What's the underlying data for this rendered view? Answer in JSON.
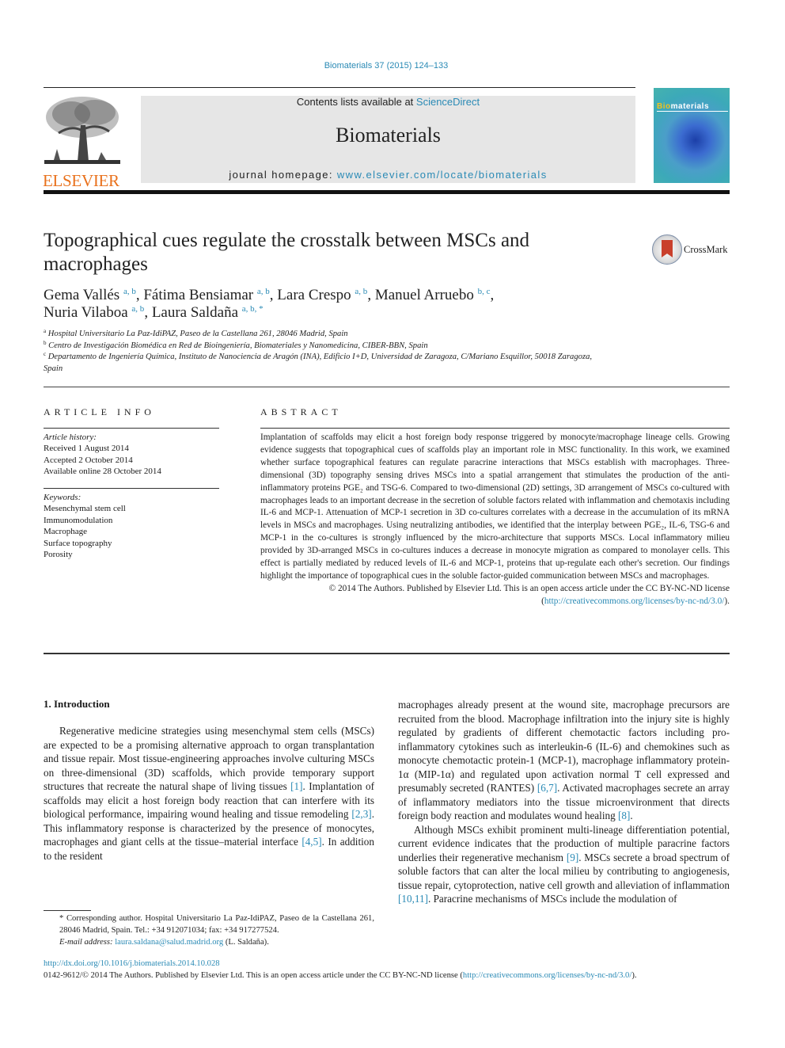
{
  "header": {
    "journal_ref": "Biomaterials 37 (2015) 124–133",
    "contents_prefix": "Contents lists available at ",
    "contents_link": "ScienceDirect",
    "journal_name": "Biomaterials",
    "homepage_prefix": "journal homepage: ",
    "homepage_link": "www.elsevier.com/locate/biomaterials",
    "publisher_logo_text": "ELSEVIER",
    "cover_title_highlight": "Bio",
    "cover_title_rest": "materials",
    "crossmark_label": "CrossMark",
    "colors": {
      "link": "#2a8ab5",
      "elsevier_orange": "#e9711c",
      "banner_bg": "#e6e6e6"
    }
  },
  "article": {
    "title": "Topographical cues regulate the crosstalk between MSCs and macrophages",
    "authors": [
      {
        "name": "Gema Vallés",
        "affil": "a, b",
        "sep": ", "
      },
      {
        "name": "Fátima Bensiamar",
        "affil": "a, b",
        "sep": ", "
      },
      {
        "name": "Lara Crespo",
        "affil": "a, b",
        "sep": ", "
      },
      {
        "name": "Manuel Arruebo",
        "affil": "b, c",
        "sep": ","
      },
      {
        "name": "Nuria Vilaboa",
        "affil": "a, b",
        "sep": ", "
      },
      {
        "name": "Laura Saldaña",
        "affil": "a, b, *",
        "sep": ""
      }
    ],
    "affiliations": [
      {
        "key": "a",
        "text": "Hospital Universitario La Paz-IdiPAZ, Paseo de la Castellana 261, 28046 Madrid, Spain"
      },
      {
        "key": "b",
        "text": "Centro de Investigación Biomédica en Red de Bioingeniería, Biomateriales y Nanomedicina, CIBER-BBN, Spain"
      },
      {
        "key": "c",
        "text": "Departamento de Ingeniería Química, Instituto de Nanociencia de Aragón (INA), Edificio I+D, Universidad de Zaragoza, C/Mariano Esquillor, 50018 Zaragoza, Spain"
      }
    ]
  },
  "article_info": {
    "heading": "ARTICLE INFO",
    "history_label": "Article history:",
    "received": "Received 1 August 2014",
    "accepted": "Accepted 2 October 2014",
    "online": "Available online 28 October 2014",
    "keywords_label": "Keywords:",
    "keywords": [
      "Mesenchymal stem cell",
      "Immunomodulation",
      "Macrophage",
      "Surface topography",
      "Porosity"
    ]
  },
  "abstract": {
    "heading": "ABSTRACT",
    "text": "Implantation of scaffolds may elicit a host foreign body response triggered by monocyte/macrophage lineage cells. Growing evidence suggests that topographical cues of scaffolds play an important role in MSC functionality. In this work, we examined whether surface topographical features can regulate paracrine interactions that MSCs establish with macrophages. Three-dimensional (3D) topography sensing drives MSCs into a spatial arrangement that stimulates the production of the anti-inflammatory proteins PGE₂ and TSG-6. Compared to two-dimensional (2D) settings, 3D arrangement of MSCs co-cultured with macrophages leads to an important decrease in the secretion of soluble factors related with inflammation and chemotaxis including IL-6 and MCP-1. Attenuation of MCP-1 secretion in 3D co-cultures correlates with a decrease in the accumulation of its mRNA levels in MSCs and macrophages. Using neutralizing antibodies, we identified that the interplay between PGE₂, IL-6, TSG-6 and MCP-1 in the co-cultures is strongly influenced by the micro-architecture that supports MSCs. Local inflammatory milieu provided by 3D-arranged MSCs in co-cultures induces a decrease in monocyte migration as compared to monolayer cells. This effect is partially mediated by reduced levels of IL-6 and MCP-1, proteins that up-regulate each other's secretion. Our findings highlight the importance of topographical cues in the soluble factor-guided communication between MSCs and macrophages.",
    "copyright_prefix": "© 2014 The Authors. Published by Elsevier Ltd. This is an open access article under the CC BY-NC-ND license (",
    "license_link": "http://creativecommons.org/licenses/by-nc-nd/3.0/",
    "copyright_suffix": ")."
  },
  "body": {
    "section_heading": "1.  Introduction",
    "left_col": {
      "p1_a": "Regenerative medicine strategies using mesenchymal stem cells (MSCs) are expected to be a promising alternative approach to organ transplantation and tissue repair. Most tissue-engineering approaches involve culturing MSCs on three-dimensional (3D) scaffolds, which provide temporary support structures that recreate the natural shape of living tissues ",
      "ref1": "[1]",
      "p1_b": ". Implantation of scaffolds may elicit a host foreign body reaction that can interfere with its biological performance, impairing wound healing and tissue remodeling ",
      "ref2": "[2,3]",
      "p1_c": ". This inflammatory response is characterized by the presence of monocytes, macrophages and giant cells at the tissue–material interface ",
      "ref3": "[4,5]",
      "p1_d": ". In addition to the resident"
    },
    "right_col": {
      "p1_a": "macrophages already present at the wound site, macrophage precursors are recruited from the blood. Macrophage infiltration into the injury site is highly regulated by gradients of different chemotactic factors including pro-inflammatory cytokines such as interleukin-6 (IL-6) and chemokines such as monocyte chemotactic protein-1 (MCP-1), macrophage inflammatory protein-1α (MIP-1α) and regulated upon activation normal T cell expressed and presumably secreted (RANTES) ",
      "ref1": "[6,7]",
      "p1_b": ". Activated macrophages secrete an array of inflammatory mediators into the tissue microenvironment that directs foreign body reaction and modulates wound healing ",
      "ref2": "[8]",
      "p1_c": ".",
      "p2_a": "Although MSCs exhibit prominent multi-lineage differentiation potential, current evidence indicates that the production of multiple paracrine factors underlies their regenerative mechanism ",
      "ref3": "[9]",
      "p2_b": ". MSCs secrete a broad spectrum of soluble factors that can alter the local milieu by contributing to angiogenesis, tissue repair, cytoprotection, native cell growth and alleviation of inflammation ",
      "ref4": "[10,11]",
      "p2_c": ". Paracrine mechanisms of MSCs include the modulation of"
    }
  },
  "footnote": {
    "corresponding": "* Corresponding author. Hospital Universitario La Paz-IdiPAZ, Paseo de la Castellana 261, 28046 Madrid, Spain. Tel.: +34 912071034; fax: +34 917277524.",
    "email_label": "E-mail address: ",
    "email": "laura.saldana@salud.madrid.org",
    "email_suffix": " (L. Saldaña)."
  },
  "footer": {
    "doi": "http://dx.doi.org/10.1016/j.biomaterials.2014.10.028",
    "issn_prefix": "0142-9612/© 2014 The Authors. Published by Elsevier Ltd. This is an open access article under the CC BY-NC-ND license (",
    "license_link": "http://creativecommons.org/licenses/by-nc-nd/3.0/",
    "issn_suffix": ")."
  }
}
